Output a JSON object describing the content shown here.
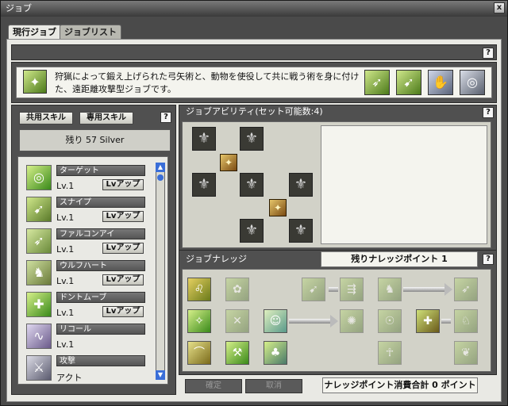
{
  "window": {
    "title": "ジョブ",
    "close": "x"
  },
  "tabs": [
    {
      "label": "現行ジョブ"
    },
    {
      "label": "ジョブリスト"
    }
  ],
  "help": "?",
  "description": "狩猟によって鍛え上げられた弓矢術と、動物を使役して共に戦う術を身に付けた、遠距離攻撃型ジョブです。",
  "skill_tabs": {
    "common": "共用スキル",
    "exclusive": "専用スキル"
  },
  "silver": "残り 57 Silver",
  "skills": [
    {
      "name": "ターゲット",
      "level": "Lv.1",
      "button": "Lvアップ"
    },
    {
      "name": "スナイプ",
      "level": "Lv.1",
      "button": "Lvアップ"
    },
    {
      "name": "ファルコンアイ",
      "level": "Lv.1",
      "button": "Lvアップ"
    },
    {
      "name": "ウルフハート",
      "level": "Lv.1",
      "button": "Lvアップ"
    },
    {
      "name": "ドントムーブ",
      "level": "Lv.1",
      "button": "Lvアップ"
    },
    {
      "name": "リコール",
      "level": "Lv.1",
      "button": ""
    },
    {
      "name": "攻撃",
      "level": "アクト",
      "button": ""
    }
  ],
  "ability": {
    "title": "ジョブアビリティ(セット可能数:4)"
  },
  "knowledge": {
    "title": "ジョブナレッジ",
    "remaining": "残りナレッジポイント 1",
    "total": "ナレッジポイント消費合計 0 ポイント"
  },
  "buttons": {
    "confirm": "確定",
    "cancel": "取消"
  },
  "colors": {
    "accent": "#5a8a1e",
    "panel": "#e9e9e4",
    "scroll": "#3a6ed8"
  }
}
